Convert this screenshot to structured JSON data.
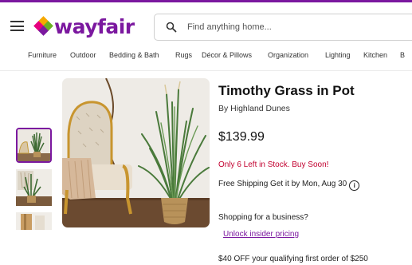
{
  "header": {
    "logo_text": "wayfair",
    "search_placeholder": "Find anything home...",
    "brand_color": "#7b189f"
  },
  "nav": {
    "items": [
      "Furniture",
      "Outdoor",
      "Bedding & Bath",
      "Rugs",
      "Décor & Pillows",
      "Organization",
      "Lighting",
      "Kitchen",
      "B"
    ]
  },
  "product": {
    "title": "Timothy Grass in Pot",
    "brand": "By Highland Dunes",
    "price": "$139.99",
    "stock": "Only 6 Left in Stock. Buy Soon!",
    "shipping": "Free Shipping Get it by Mon, Aug 30",
    "business_prompt": "Shopping for a business?",
    "insider_link": "Unlock insider pricing",
    "offer": "$40 OFF your qualifying first order of $250"
  },
  "icons": [
    "menu-icon",
    "search-icon",
    "info-icon"
  ],
  "colors": {
    "stock": "#c2002f",
    "link": "#7b189f"
  }
}
